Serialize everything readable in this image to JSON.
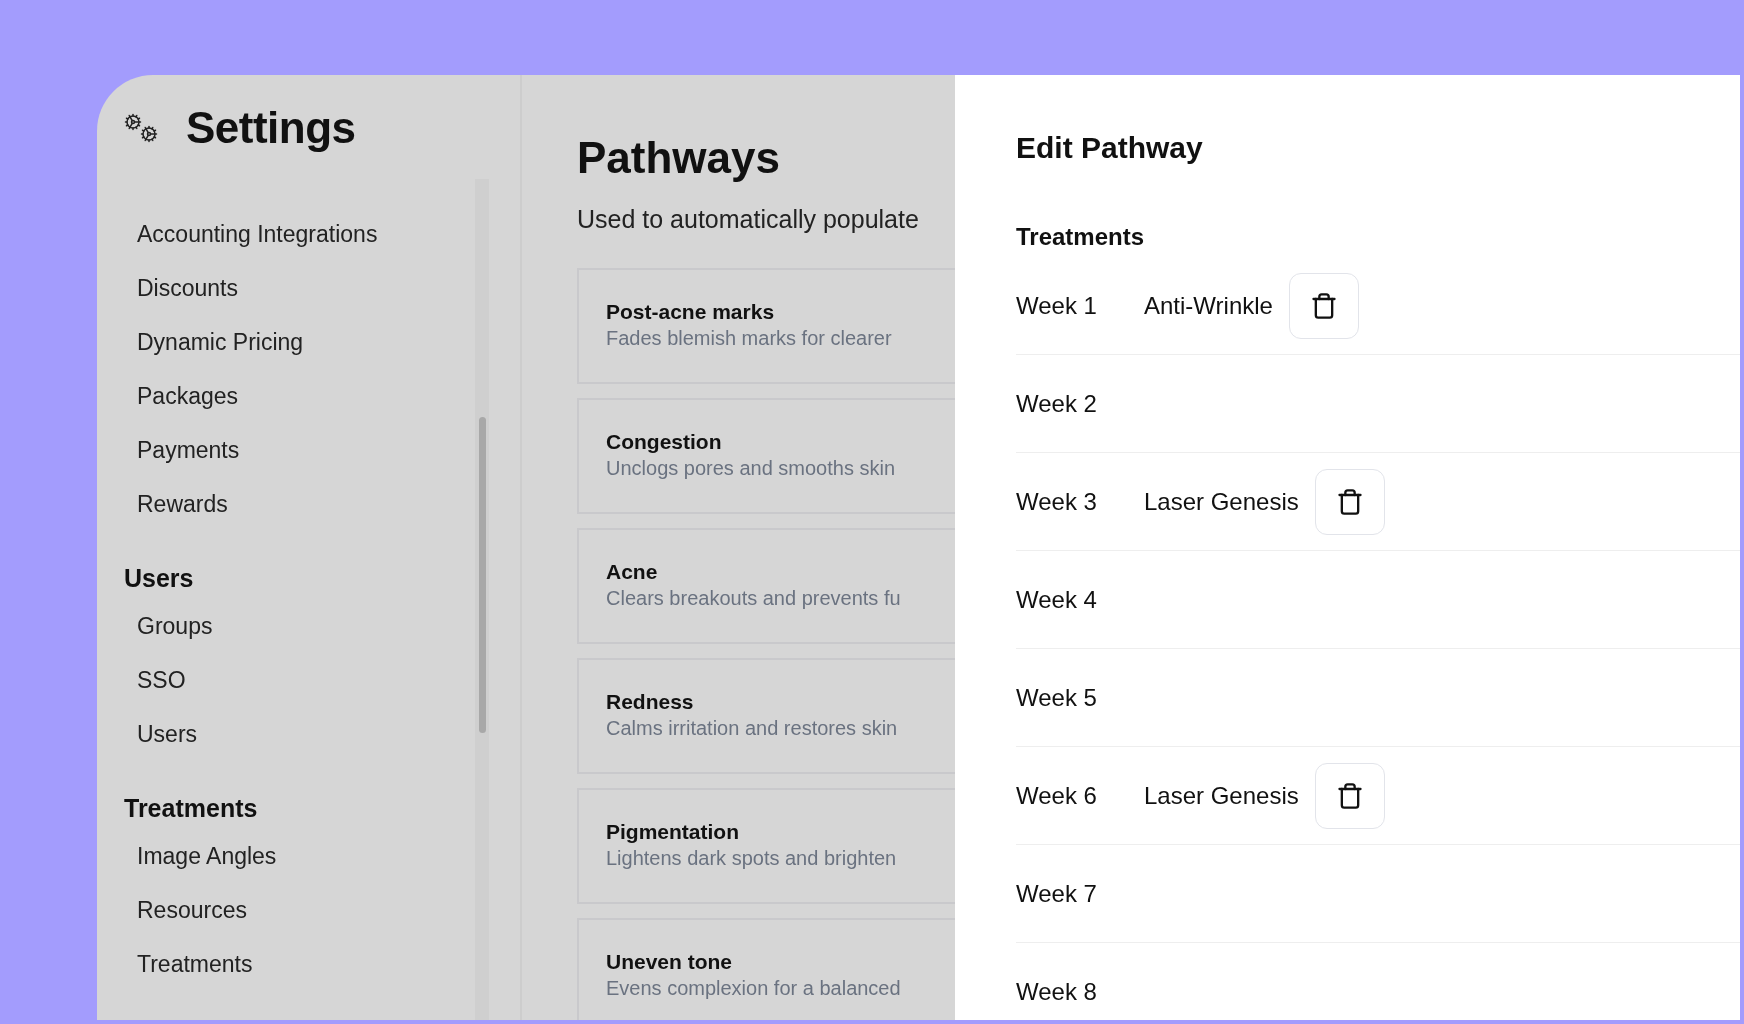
{
  "sidebar": {
    "title": "Settings",
    "sections": [
      {
        "items": [
          "Accounting Integrations",
          "Discounts",
          "Dynamic Pricing",
          "Packages",
          "Payments",
          "Rewards"
        ]
      },
      {
        "heading": "Users",
        "items": [
          "Groups",
          "SSO",
          "Users"
        ]
      },
      {
        "heading": "Treatments",
        "items": [
          "Image Angles",
          "Resources",
          "Treatments"
        ]
      }
    ]
  },
  "main": {
    "title": "Pathways",
    "subtitle": "Used to automatically populate",
    "pathways": [
      {
        "name": "Post-acne marks",
        "description": "Fades blemish marks for clearer"
      },
      {
        "name": "Congestion",
        "description": "Unclogs pores and smooths skin"
      },
      {
        "name": "Acne",
        "description": "Clears breakouts and prevents fu"
      },
      {
        "name": "Redness",
        "description": "Calms irritation and restores skin"
      },
      {
        "name": "Pigmentation",
        "description": "Lightens dark spots and brighten"
      },
      {
        "name": "Uneven tone",
        "description": "Evens complexion for a balanced"
      }
    ]
  },
  "panel": {
    "title": "Edit Pathway",
    "section": "Treatments",
    "weeks": [
      {
        "label": "Week 1",
        "treatment": "Anti-Wrinkle"
      },
      {
        "label": "Week 2"
      },
      {
        "label": "Week 3",
        "treatment": "Laser Genesis"
      },
      {
        "label": "Week 4"
      },
      {
        "label": "Week 5"
      },
      {
        "label": "Week 6",
        "treatment": "Laser Genesis"
      },
      {
        "label": "Week 7"
      },
      {
        "label": "Week 8"
      }
    ]
  }
}
